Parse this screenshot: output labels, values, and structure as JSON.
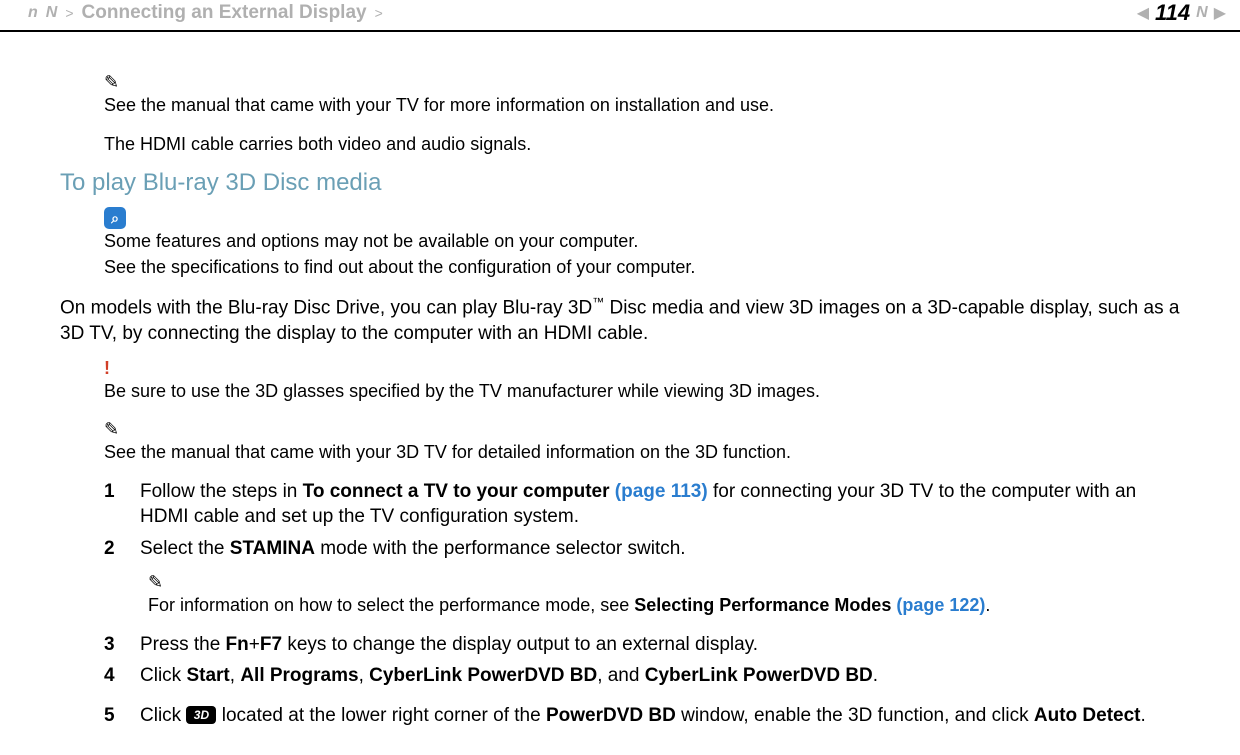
{
  "header": {
    "nLabel": "n",
    "NLabel": "N",
    "breadcrumb": "Connecting an External Display",
    "pageNumber": "114"
  },
  "note1": {
    "line1": "See the manual that came with your TV for more information on installation and use."
  },
  "condLine": "The HDMI cable carries both video and audio signals.",
  "sectionTitle": "To play Blu-ray 3D Disc media",
  "infoBox": {
    "line1": "Some features and options may not be available on your computer.",
    "line2": "See the specifications to find out about the configuration of your computer."
  },
  "bodyPara": {
    "pre": "On models with the Blu-ray Disc Drive, you can play Blu-ray 3D",
    "tm": "™",
    "post": " Disc media and view 3D images on a 3D-capable display, such as a 3D TV, by connecting the display to the computer with an HDMI cable."
  },
  "warn": {
    "mark": "!",
    "text": "Be sure to use the 3D glasses specified by the TV manufacturer while viewing 3D images."
  },
  "note2": {
    "text": "See the manual that came with your 3D TV for detailed information on the 3D function."
  },
  "steps": {
    "s1": {
      "num": "1",
      "pre": "Follow the steps in ",
      "bold1": "To connect a TV to your computer ",
      "link": "(page 113)",
      "post": " for connecting your 3D TV to the computer with an HDMI cable and set up the TV configuration system."
    },
    "s2": {
      "num": "2",
      "pre": "Select the ",
      "bold": "STAMINA",
      "post": " mode with the performance selector switch."
    },
    "noteInner": {
      "pre": "For information on how to select the performance mode, see ",
      "bold": "Selecting Performance Modes ",
      "link": "(page 122)",
      "post": "."
    },
    "s3": {
      "num": "3",
      "pre": "Press the ",
      "bold": "Fn",
      "plus": "+",
      "bold2": "F7",
      "post": " keys to change the display output to an external display."
    },
    "s4": {
      "num": "4",
      "pre": "Click ",
      "b1": "Start",
      "c1": ", ",
      "b2": "All Programs",
      "c2": ", ",
      "b3": "CyberLink PowerDVD BD",
      "c3": ", and ",
      "b4": "CyberLink PowerDVD BD",
      "c4": "."
    },
    "s5": {
      "num": "5",
      "pre": "Click ",
      "iconLabel": "3D",
      "mid": " located at the lower right corner of the ",
      "b1": "PowerDVD BD",
      "mid2": " window, enable the 3D function, and click ",
      "b2": "Auto Detect",
      "post": "."
    }
  }
}
